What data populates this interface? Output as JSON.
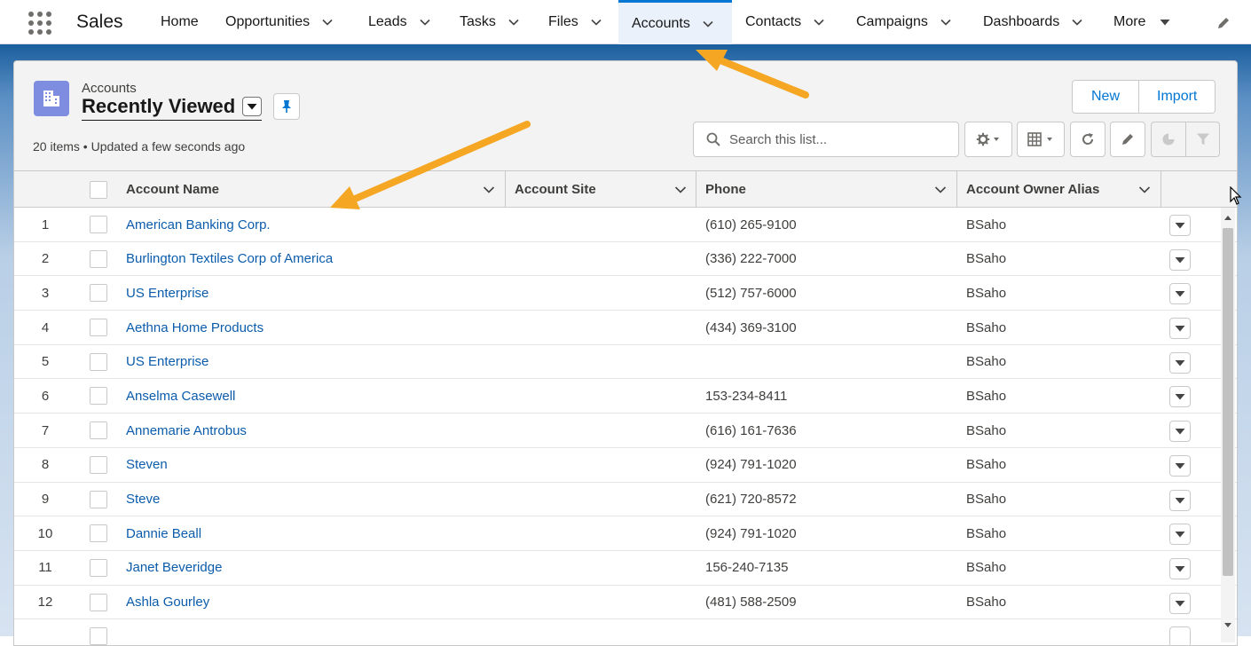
{
  "app": {
    "name": "Sales"
  },
  "nav": {
    "items": [
      {
        "label": "Home",
        "has_menu": false
      },
      {
        "label": "Opportunities",
        "has_menu": true
      },
      {
        "label": "Leads",
        "has_menu": true
      },
      {
        "label": "Tasks",
        "has_menu": true
      },
      {
        "label": "Files",
        "has_menu": true
      },
      {
        "label": "Accounts",
        "has_menu": true,
        "active": true
      },
      {
        "label": "Contacts",
        "has_menu": true
      },
      {
        "label": "Campaigns",
        "has_menu": true
      },
      {
        "label": "Dashboards",
        "has_menu": true
      },
      {
        "label": "More",
        "has_menu": true
      }
    ]
  },
  "header": {
    "object_label": "Accounts",
    "list_view_name": "Recently Viewed",
    "meta": "20 items • Updated a few seconds ago",
    "buttons": {
      "new": "New",
      "import": "Import"
    }
  },
  "search": {
    "placeholder": "Search this list...",
    "value": ""
  },
  "table": {
    "columns": [
      "Account Name",
      "Account Site",
      "Phone",
      "Account Owner Alias"
    ],
    "rows": [
      {
        "num": "1",
        "name": "American Banking Corp.",
        "site": "",
        "phone": "(610) 265-9100",
        "owner": "BSaho"
      },
      {
        "num": "2",
        "name": "Burlington Textiles Corp of America",
        "site": "",
        "phone": "(336) 222-7000",
        "owner": "BSaho"
      },
      {
        "num": "3",
        "name": "US Enterprise",
        "site": "",
        "phone": "(512) 757-6000",
        "owner": "BSaho"
      },
      {
        "num": "4",
        "name": "Aethna Home Products",
        "site": "",
        "phone": "(434) 369-3100",
        "owner": "BSaho"
      },
      {
        "num": "5",
        "name": "US Enterprise",
        "site": "",
        "phone": "",
        "owner": "BSaho"
      },
      {
        "num": "6",
        "name": "Anselma Casewell",
        "site": "",
        "phone": "153-234-8411",
        "owner": "BSaho"
      },
      {
        "num": "7",
        "name": "Annemarie Antrobus",
        "site": "",
        "phone": "(616) 161-7636",
        "owner": "BSaho"
      },
      {
        "num": "8",
        "name": "Steven",
        "site": "",
        "phone": "(924) 791-1020",
        "owner": "BSaho"
      },
      {
        "num": "9",
        "name": "Steve",
        "site": "",
        "phone": "(621) 720-8572",
        "owner": "BSaho"
      },
      {
        "num": "10",
        "name": "Dannie Beall",
        "site": "",
        "phone": "(924) 791-1020",
        "owner": "BSaho"
      },
      {
        "num": "11",
        "name": "Janet Beveridge",
        "site": "",
        "phone": "156-240-7135",
        "owner": "BSaho"
      },
      {
        "num": "12",
        "name": "Ashla Gourley",
        "site": "",
        "phone": "(481) 588-2509",
        "owner": "BSaho"
      }
    ]
  },
  "colors": {
    "brand_blue": "#0176d3",
    "link_blue": "#0b5cab",
    "object_icon": "#7f8de1",
    "annotation_arrow": "#f5a623"
  },
  "icons": {
    "app_launcher": "waffle-icon",
    "object": "account-building-icon",
    "pin": "pin-icon",
    "search": "search-icon",
    "settings": "gear-icon",
    "display": "table-display-icon",
    "refresh": "refresh-icon",
    "edit": "pencil-icon",
    "chart": "chart-icon",
    "filter": "filter-icon"
  }
}
